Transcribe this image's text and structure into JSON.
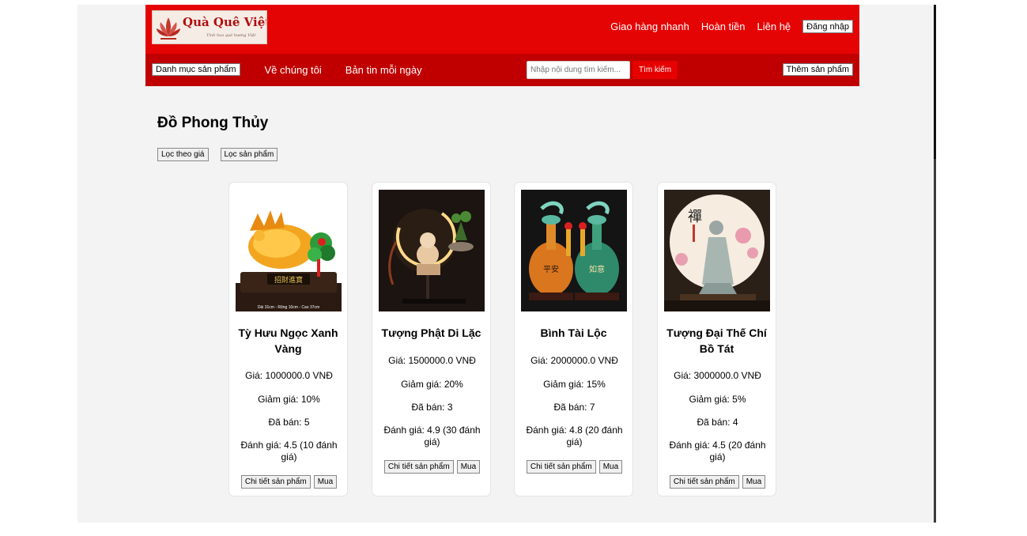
{
  "header": {
    "logo": {
      "brand": "Quà Quê Việt",
      "tagline": "Tinh hoa quê hương Việt"
    },
    "top_links": [
      "Giao hàng nhanh",
      "Hoàn tiền",
      "Liên hệ"
    ],
    "login_label": "Đăng nhập"
  },
  "nav": {
    "category_label": "Danh mục sản phẩm",
    "links": [
      "Về chúng tôi",
      "Bản tin mỗi ngày"
    ],
    "search_placeholder": "Nhập nội dung tìm kiếm...",
    "search_label": "Tìm kiếm",
    "add_product_label": "Thêm sản phẩm"
  },
  "main": {
    "title": "Đồ Phong Thủy",
    "filters": [
      "Lọc theo giá",
      "Lọc sản phẩm"
    ],
    "products": [
      {
        "name": "Tỳ Hưu Ngọc Xanh Vàng",
        "price": "Giá: 1000000.0 VNĐ",
        "discount": "Giảm giá: 10%",
        "sold": "Đã bán: 5",
        "rating": "Đánh giá: 4.5 (10 đánh giá)",
        "detail_label": "Chi tiết sản phẩm",
        "buy_label": "Mua",
        "image_caption": "Dài 31cm - Rộng 10cm - Cao 37cm"
      },
      {
        "name": "Tượng Phật Di Lặc",
        "price": "Giá: 1500000.0 VNĐ",
        "discount": "Giảm giá: 20%",
        "sold": "Đã bán: 3",
        "rating": "Đánh giá: 4.9 (30 đánh giá)",
        "detail_label": "Chi tiết sản phẩm",
        "buy_label": "Mua"
      },
      {
        "name": "Bình Tài Lộc",
        "price": "Giá: 2000000.0 VNĐ",
        "discount": "Giảm giá: 15%",
        "sold": "Đã bán: 7",
        "rating": "Đánh giá: 4.8 (20 đánh giá)",
        "detail_label": "Chi tiết sản phẩm",
        "buy_label": "Mua"
      },
      {
        "name": "Tượng Đại Thế Chí Bồ Tát",
        "price": "Giá: 3000000.0 VNĐ",
        "discount": "Giảm giá: 5%",
        "sold": "Đã bán: 4",
        "rating": "Đánh giá: 4.5 (20 đánh giá)",
        "detail_label": "Chi tiết sản phẩm",
        "buy_label": "Mua"
      }
    ]
  },
  "colors": {
    "header_red": "#e50404",
    "nav_red": "#c00000",
    "search_button": "#e60000",
    "page_bg": "#f3f3f3"
  }
}
